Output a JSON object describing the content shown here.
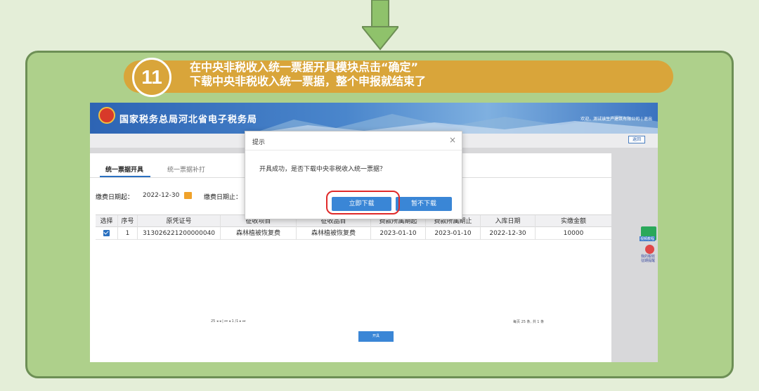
{
  "step": {
    "number": "11",
    "line1": "在中央非税收入统一票据开具模块点击“确定”",
    "line2": "下载中央非税收入统一票据，整个申报就结束了"
  },
  "site": {
    "title": "国家税务总局河北省电子税务局",
    "user": "欢迎，测试该生产建筑有限公司 | 退出",
    "back": "返回"
  },
  "tabs": [
    "统一票据开具",
    "统一票据补打"
  ],
  "filters": {
    "start_label": "缴费日期起：",
    "start_value": "2022-12-30",
    "end_label": "缴费日期止："
  },
  "table": {
    "headers": [
      "选择",
      "序号",
      "原凭证号",
      "征收项目",
      "征收品目",
      "费款所属期起",
      "费款所属期止",
      "入库日期",
      "实缴金额"
    ],
    "row": [
      "",
      "1",
      "313026221200000040",
      "森林植被恢复费",
      "森林植被恢复费",
      "2023-01-10",
      "2023-01-10",
      "2022-12-30",
      "10000"
    ]
  },
  "pager": {
    "left": "25  ◂ ◂ | ⏮ ◂  1  /1 ▸ ⏭",
    "right": "每页 25 条, 共 1 条",
    "issue_btn": "开具"
  },
  "side": {
    "item1": "视频教程",
    "item2": "我的税收\n征期提醒"
  },
  "dialog": {
    "title": "提示",
    "close": "×",
    "message": "开具成功，是否下载中央非税收入统一票据？",
    "download": "立即下载",
    "later": "暂不下载"
  },
  "colors": {
    "page_bg": "#e4eed8",
    "card_bg": "#aed08b",
    "banner": "#d9a53a",
    "primary_button": "#3a86d6",
    "highlight_ring": "#e02a2a"
  }
}
